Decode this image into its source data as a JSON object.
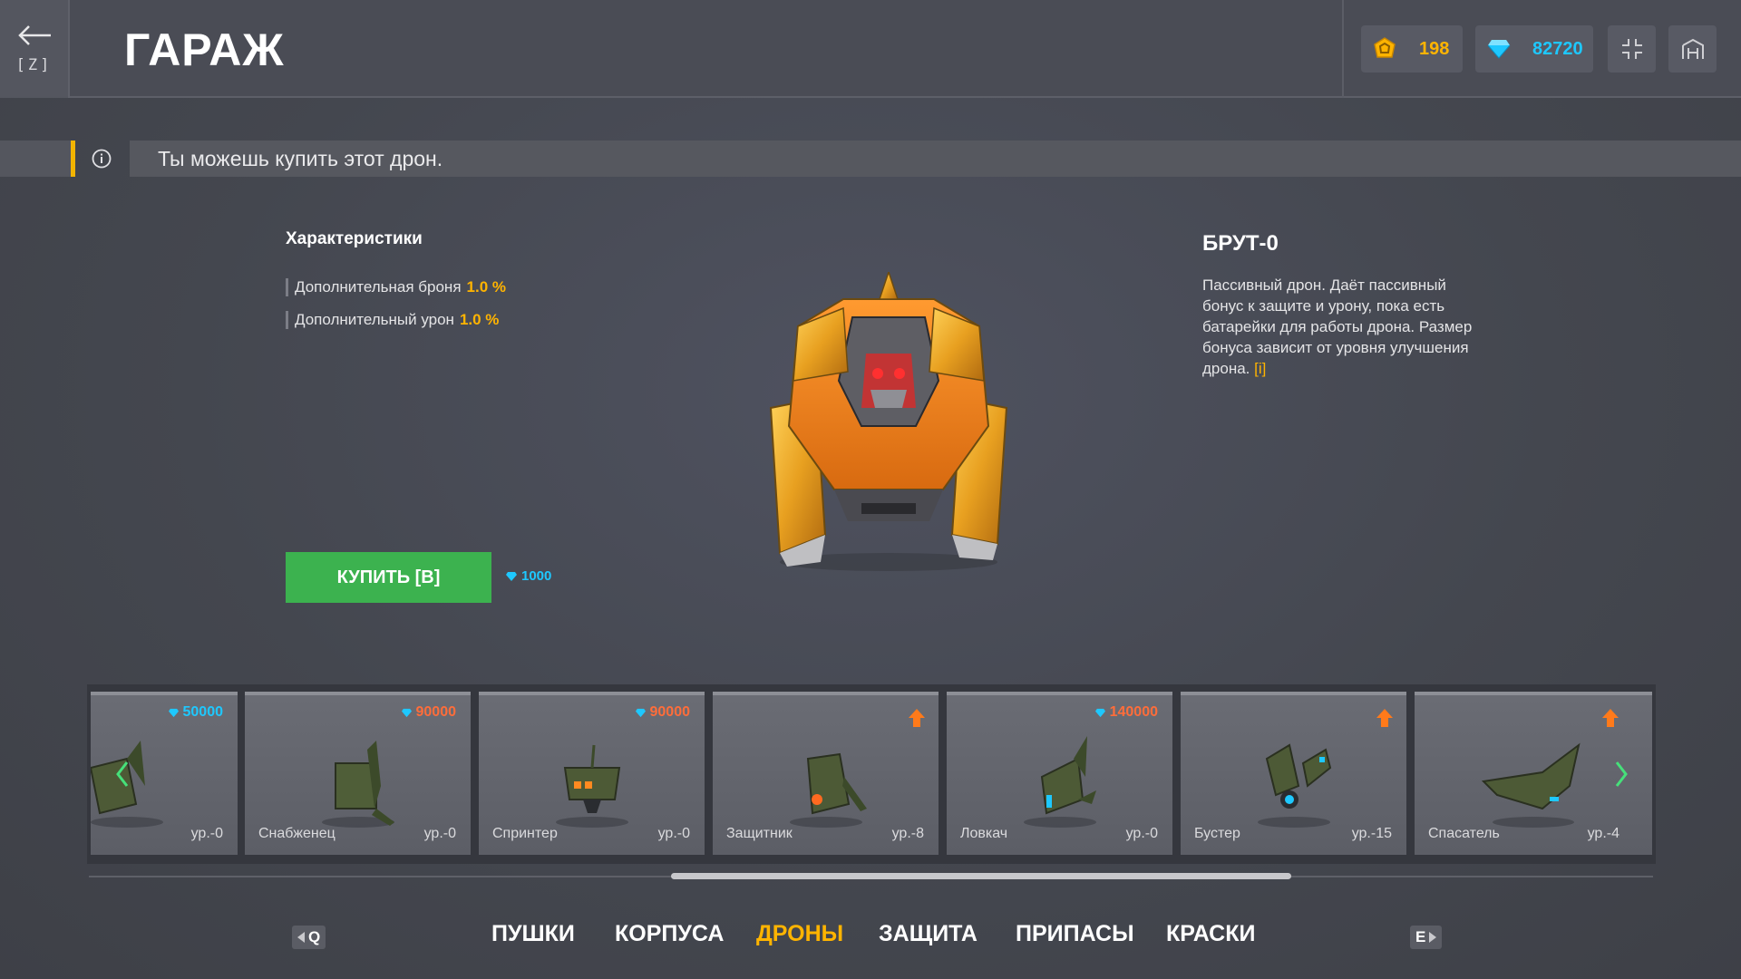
{
  "header": {
    "back_key": "[Z]",
    "title": "ГАРАЖ",
    "coins": "198",
    "crystals": "82720",
    "icons": [
      "arrow-left-icon",
      "coin-icon",
      "crystal-icon",
      "collapse-icon",
      "hangar-icon"
    ]
  },
  "info": {
    "message": "Ты можешь купить этот дрон."
  },
  "characteristics": {
    "title": "Характеристики",
    "stats": [
      {
        "label": "Дополнительная броня",
        "value": "1.0 %"
      },
      {
        "label": "Дополнительный урон",
        "value": "1.0 %"
      }
    ]
  },
  "buy": {
    "label": "КУПИТЬ [B]",
    "price": "1000"
  },
  "drone": {
    "name": "БРУТ-0",
    "description": "Пассивный дрон. Даёт пассивный бонус к защите и урону, пока есть батарейки для работы дрона. Размер бонуса зависит от уровня улучшения дрона.",
    "info_link": "[i]"
  },
  "carousel": {
    "items": [
      {
        "name": "",
        "level": "ур.-0",
        "price": "50000",
        "price_color": "blue"
      },
      {
        "name": "Снабженец",
        "level": "ур.-0",
        "price": "90000",
        "price_color": "orange"
      },
      {
        "name": "Спринтер",
        "level": "ур.-0",
        "price": "90000",
        "price_color": "orange"
      },
      {
        "name": "Защитник",
        "level": "ур.-8",
        "price": "",
        "upgrade": true
      },
      {
        "name": "Ловкач",
        "level": "ур.-0",
        "price": "140000",
        "price_color": "orange"
      },
      {
        "name": "Бустер",
        "level": "ур.-15",
        "price": "",
        "upgrade": true
      },
      {
        "name": "Спасатель",
        "level": "ур.-4",
        "price": "",
        "upgrade": true
      }
    ]
  },
  "tabs": {
    "prev_key": "Q",
    "next_key": "E",
    "items": [
      "ПУШКИ",
      "КОРПУСА",
      "ДРОНЫ",
      "ЗАЩИТА",
      "ПРИПАСЫ",
      "КРАСКИ"
    ],
    "active": "ДРОНЫ"
  },
  "colors": {
    "accent": "#ffb400",
    "crystal": "#1ec8ff",
    "buy_button": "#3cb24f",
    "expensive_price": "#ff6d3a"
  }
}
